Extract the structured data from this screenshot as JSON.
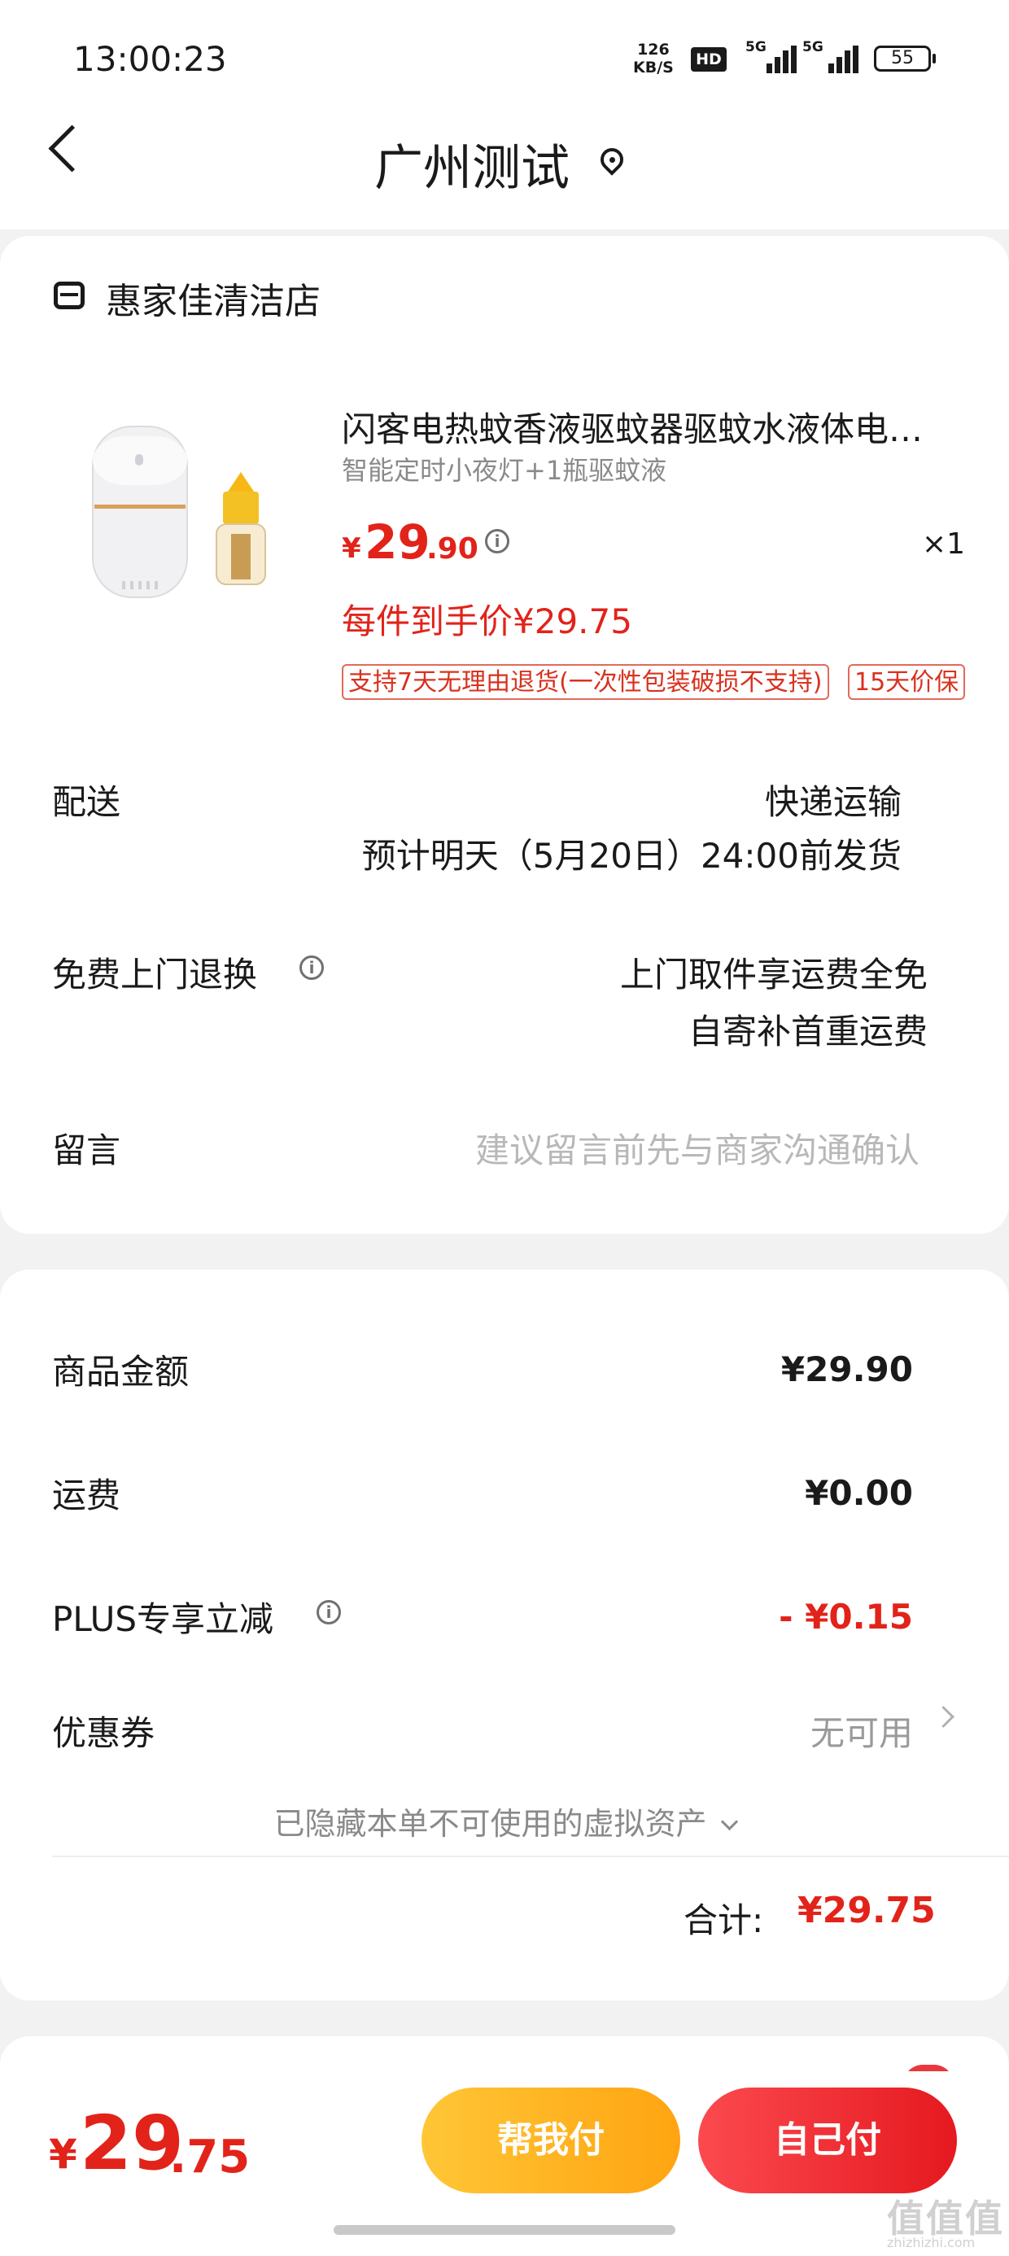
{
  "status_bar": {
    "time": "13:00:23",
    "net_speed_value": "126",
    "net_speed_unit": "KB/S",
    "hd_label": "HD",
    "signal1_label": "5G",
    "signal2_label": "5G",
    "battery": "55"
  },
  "nav": {
    "title": "广州测试"
  },
  "store": {
    "name": "惠家佳清洁店"
  },
  "product": {
    "title": "闪客电热蚊香液驱蚊器驱蚊水液体电蚊香家用婴儿孕妇",
    "spec": "智能定时小夜灯+1瓶驱蚊液",
    "price_symbol": "¥",
    "price_int": "29",
    "price_dec": ".90",
    "qty": "×1",
    "final_price": "每件到手价¥29.75",
    "tags": [
      "支持7天无理由退货(一次性包装破损不支持)",
      "15天价保"
    ]
  },
  "delivery": {
    "label": "配送",
    "method": "快递运输",
    "eta": "预计明天（5月20日）24:00前发货"
  },
  "return": {
    "label": "免费上门退换",
    "line1": "上门取件享运费全免",
    "line2": "自寄补首重运费"
  },
  "message": {
    "label": "留言",
    "placeholder": "建议留言前先与商家沟通确认"
  },
  "summary": {
    "goods_label": "商品金额",
    "goods_value": "¥29.90",
    "shipping_label": "运费",
    "shipping_value": "¥0.00",
    "plus_label": "PLUS专享立减",
    "plus_value": "- ¥0.15",
    "coupon_label": "优惠券",
    "coupon_value": "无可用",
    "hidden_note": "已隐藏本单不可使用的虚拟资产",
    "total_label": "合计:",
    "total_value": "¥29.75"
  },
  "bottom": {
    "price_symbol": "¥",
    "price_int": "29",
    "price_dec": ".75",
    "help_pay": "帮我付",
    "self_pay": "自己付"
  },
  "watermark": {
    "main": "值值值",
    "sub": "zhizhizhi.com"
  },
  "colors": {
    "accent_red": "#e2231a",
    "help_yellow": "#ffb81f",
    "self_red": "#f0282e"
  }
}
